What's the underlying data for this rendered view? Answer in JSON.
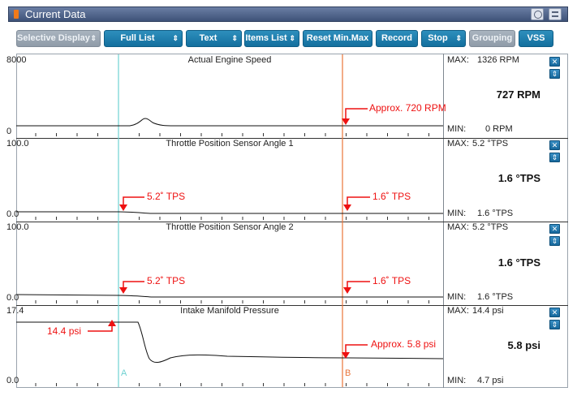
{
  "window": {
    "title": "Current Data",
    "setup_icon": "setup-icon",
    "menu_icon": "menu-icon"
  },
  "toolbar": {
    "selective_display": "Selective Display",
    "full_list": "Full List",
    "text": "Text",
    "items_list": "Items List",
    "reset_min_max": "Reset Min.Max",
    "record": "Record",
    "stop": "Stop",
    "grouping": "Grouping",
    "vss": "VSS",
    "dropdown_arrow": "⇕"
  },
  "cursors": {
    "a_label": "A",
    "b_label": "B",
    "a_color": "#6fd1d1",
    "b_color": "#e8743a"
  },
  "colors": {
    "annotation": "#ee1111",
    "trace": "#111111",
    "button": "#1f7fb0"
  },
  "labels": {
    "max": "MAX:",
    "min": "MIN:"
  },
  "strips": [
    {
      "title": "Actual Engine Speed",
      "y_max": "8000",
      "y_min": "0",
      "max_value": "1326 RPM",
      "current_value": "727 RPM",
      "min_value": "0 RPM",
      "annotations": [
        {
          "text": "Approx. 720 RPM"
        }
      ]
    },
    {
      "title": "Throttle Position Sensor Angle 1",
      "y_max": "100.0",
      "y_min": "0.0",
      "max_value": "5.2 °TPS",
      "current_value": "1.6 °TPS",
      "min_value": "1.6 °TPS",
      "annotations": [
        {
          "text": "5.2˚ TPS"
        },
        {
          "text": "1.6˚ TPS"
        }
      ]
    },
    {
      "title": "Throttle Position Sensor Angle 2",
      "y_max": "100.0",
      "y_min": "0.0",
      "max_value": "5.2 °TPS",
      "current_value": "1.6 °TPS",
      "min_value": "1.6 °TPS",
      "annotations": [
        {
          "text": "5.2˚ TPS"
        },
        {
          "text": "1.6˚ TPS"
        }
      ]
    },
    {
      "title": "Intake Manifold Pressure",
      "y_max": "17.4",
      "y_min": "0.0",
      "max_value": "14.4 psi",
      "current_value": "5.8 psi",
      "min_value": "4.7 psi",
      "annotations": [
        {
          "text": "14.4 psi"
        },
        {
          "text": "Approx. 5.8 psi"
        }
      ]
    }
  ]
}
